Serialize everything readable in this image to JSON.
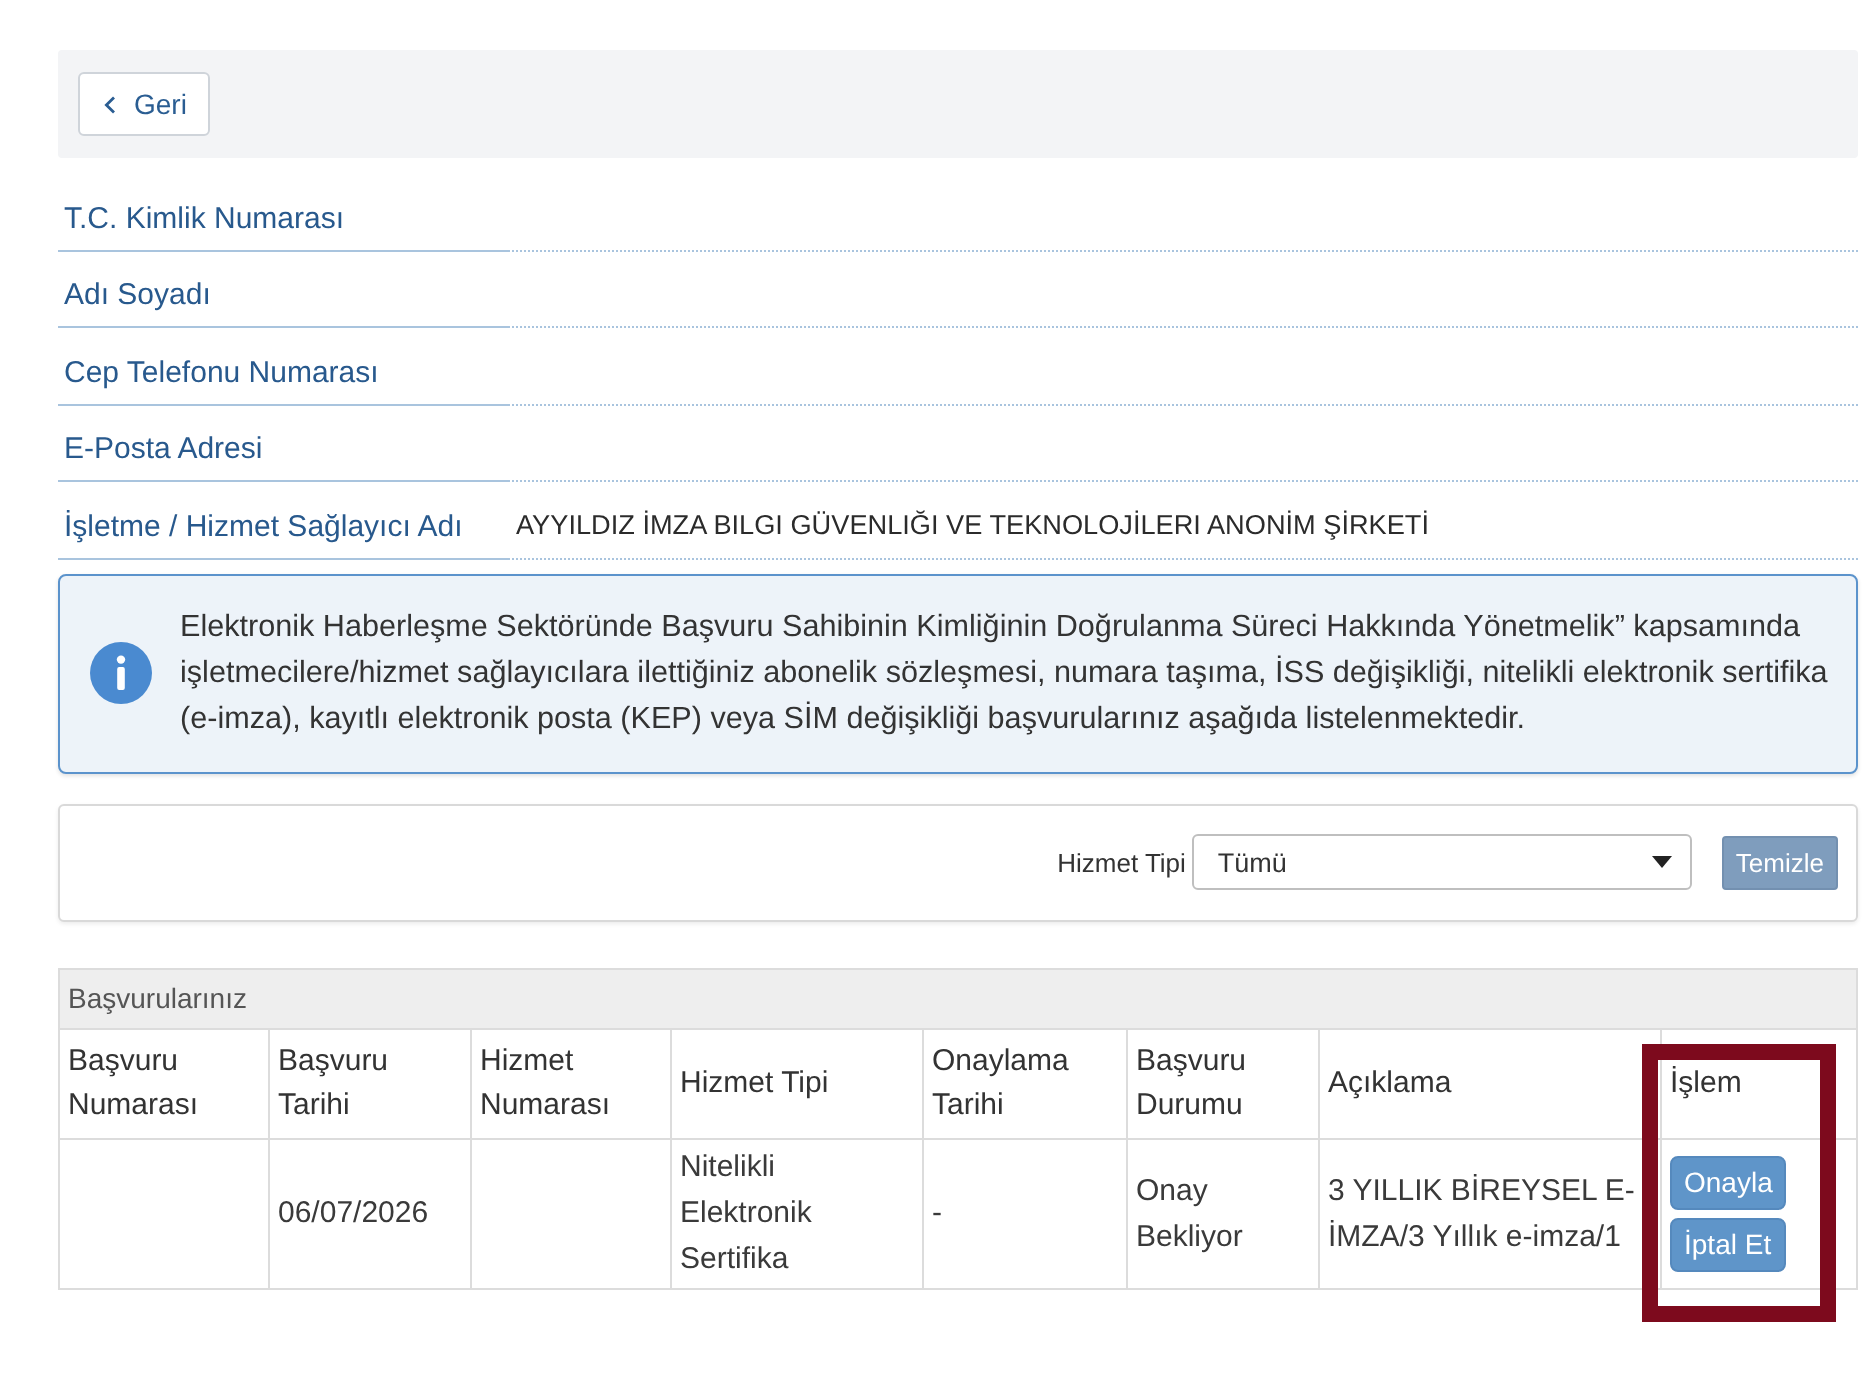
{
  "back_button": {
    "label": "Geri"
  },
  "fields": [
    {
      "label": "T.C. Kimlik Numarası"
    },
    {
      "label": "Adı Soyadı"
    },
    {
      "label": "Cep Telefonu Numarası"
    },
    {
      "label": "E-Posta Adresi"
    },
    {
      "label": "İşletme / Hizmet Sağlayıcı Adı",
      "value": "AYYILDIZ İMZA BILGI GÜVENLIĞI VE TEKNOLOJİLERI ANONİM ŞİRKETİ"
    }
  ],
  "notice": {
    "text": "Elektronik Haberleşme Sektöründe Başvuru Sahibinin Kimliğinin Doğrulanma Süreci Hakkında Yönetmelik” kapsamında işletmecilere/hizmet sağlayıcılara ilettiğiniz abonelik sözleşmesi, numara taşıma, İSS değişikliği, nitelikli elektronik sertifika (e-imza), kayıtlı elektronik posta (KEP) veya SİM değişikliği başvurularınız aşağıda listelenmektedir."
  },
  "filter": {
    "label": "Hizmet Tipi",
    "select": {
      "value": "Tümü"
    },
    "clear_button": "Temizle"
  },
  "applications": {
    "title": "Başvurularınız",
    "columns": [
      {
        "label": "Başvuru Numarası",
        "highlighted": false
      },
      {
        "label": "Başvuru Tarihi",
        "highlighted": false
      },
      {
        "label": "Hizmet Numarası",
        "highlighted": false
      },
      {
        "label": "Hizmet Tipi",
        "highlighted": false
      },
      {
        "label": "Onaylama Tarihi",
        "highlighted": false
      },
      {
        "label": "Başvuru Durumu",
        "highlighted": false
      },
      {
        "label": "Açıklama",
        "highlighted": false
      },
      {
        "label": "İşlem",
        "highlighted": true
      }
    ],
    "rows": [
      {
        "cells": [
          null,
          "06/07/2026",
          null,
          "Nitelikli Elektronik Sertifika",
          "-",
          "Onay Bekliyor",
          "3 YILLIK BİREYSEL E-İMZA/3 Yıllık e-imza/1"
        ],
        "actions": [
          "Onayla",
          "İptal Et"
        ]
      }
    ]
  }
}
